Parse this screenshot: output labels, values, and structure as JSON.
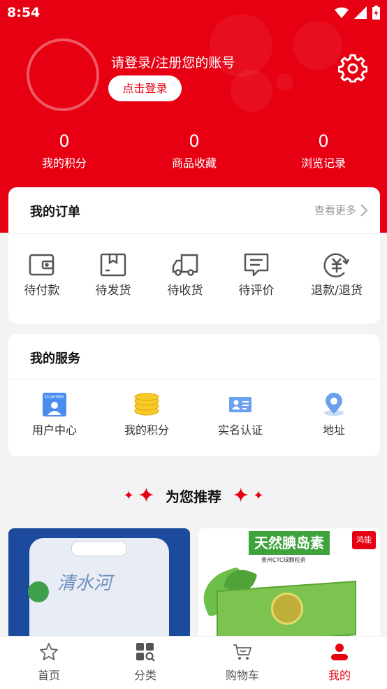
{
  "status_bar": {
    "time": "8:54"
  },
  "profile": {
    "login_prompt": "请登录/注册您的账号",
    "login_button": "点击登录"
  },
  "stats": [
    {
      "value": "0",
      "label": "我的积分"
    },
    {
      "value": "0",
      "label": "商品收藏"
    },
    {
      "value": "0",
      "label": "浏览记录"
    }
  ],
  "orders": {
    "title": "我的订单",
    "more": "查看更多",
    "items": [
      {
        "label": "待付款",
        "icon": "wallet-icon"
      },
      {
        "label": "待发货",
        "icon": "package-icon"
      },
      {
        "label": "待收货",
        "icon": "truck-icon"
      },
      {
        "label": "待评价",
        "icon": "comment-icon"
      },
      {
        "label": "退款/退货",
        "icon": "refund-icon"
      }
    ]
  },
  "services": {
    "title": "我的服务",
    "items": [
      {
        "label": "用户中心",
        "icon": "user-center-icon",
        "badge": "Ucenter"
      },
      {
        "label": "我的积分",
        "icon": "coins-icon"
      },
      {
        "label": "实名认证",
        "icon": "id-card-icon"
      },
      {
        "label": "地址",
        "icon": "location-pin-icon"
      }
    ]
  },
  "recommend": {
    "title": "为您推荐"
  },
  "products": [
    {
      "text": "清水河"
    },
    {
      "banner": "天然腆岛素",
      "brand": "鸿能",
      "subtitle": "贵州CTC绿颗粒茶"
    }
  ],
  "tabbar": [
    {
      "label": "首页",
      "icon": "star-icon"
    },
    {
      "label": "分类",
      "icon": "grid-search-icon"
    },
    {
      "label": "购物车",
      "icon": "cart-icon"
    },
    {
      "label": "我的",
      "icon": "person-icon",
      "active": true
    }
  ],
  "colors": {
    "brand_red": "#e60012",
    "text_gray": "#999999"
  }
}
